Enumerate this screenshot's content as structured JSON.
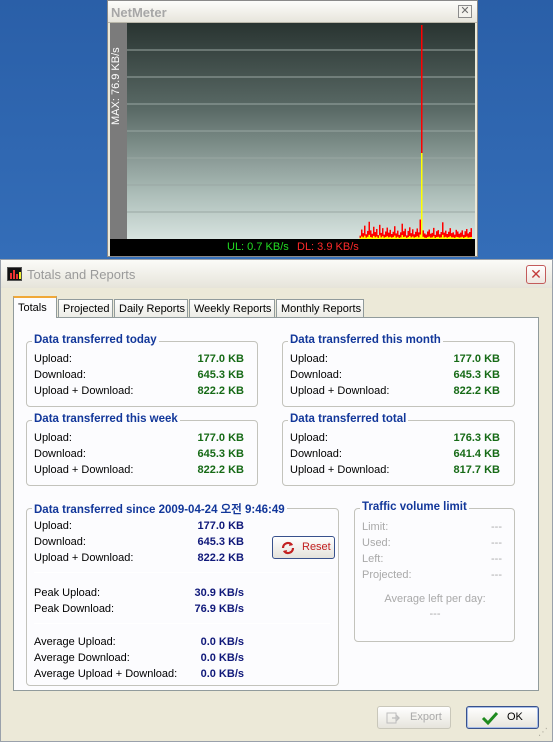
{
  "netmeter": {
    "title": "NetMeter",
    "close_label": "✕",
    "max_label": "MAX: 76.9 KB/s",
    "ul_label": "UL: 0.7 KB/s",
    "dl_label": "DL: 3.9 KB/s",
    "colors": {
      "upload": "#ffff00",
      "download": "#ff0000",
      "ul_text": "#22dd22",
      "dl_text": "#ff2a2a"
    },
    "graph": {
      "max_kbs": 76.9,
      "download_samples": [
        1.2,
        3.4,
        2.1,
        4.8,
        1.7,
        2.9,
        6.2,
        3.1,
        1.9,
        4.4,
        2.5,
        3.6,
        1.4,
        5.1,
        2.2,
        3.9,
        1.6,
        2.7,
        4.1,
        2.3,
        3.3,
        1.8,
        2.6,
        4.6,
        2.0,
        3.0,
        1.5,
        2.4,
        5.5,
        2.8,
        3.7,
        1.3,
        2.9,
        4.2,
        2.1,
        3.5,
        1.7,
        2.6,
        3.8,
        2.4,
        7.0,
        76.9,
        3.1,
        2.0,
        1.6,
        2.7,
        3.4,
        1.9,
        2.2,
        4.0,
        1.5,
        2.8,
        3.2,
        1.7,
        2.5,
        6.0,
        2.3,
        3.0,
        1.8,
        2.6,
        3.9,
        2.1,
        2.4,
        1.6,
        3.3,
        2.7,
        1.9,
        2.3,
        3.1,
        1.5,
        2.8,
        3.6,
        2.0,
        2.5,
        3.9
      ],
      "upload_samples": [
        0.4,
        0.9,
        0.6,
        1.2,
        0.5,
        0.8,
        1.5,
        0.7,
        0.5,
        1.1,
        0.6,
        0.9,
        0.4,
        1.3,
        0.6,
        1.0,
        0.5,
        0.7,
        1.0,
        0.6,
        0.8,
        0.5,
        0.7,
        1.2,
        0.5,
        0.8,
        0.4,
        0.6,
        1.4,
        0.7,
        0.9,
        0.4,
        0.7,
        1.1,
        0.6,
        0.9,
        0.5,
        0.7,
        1.0,
        0.6,
        1.6,
        30.9,
        0.8,
        0.5,
        0.4,
        0.7,
        0.9,
        0.5,
        0.6,
        1.0,
        0.4,
        0.7,
        0.8,
        0.5,
        0.6,
        1.5,
        0.6,
        0.8,
        0.5,
        0.7,
        1.0,
        0.6,
        0.6,
        0.4,
        0.8,
        0.7,
        0.5,
        0.6,
        0.8,
        0.4,
        0.7,
        0.9,
        0.5,
        0.6,
        0.7
      ]
    }
  },
  "dialog": {
    "title": "Totals and Reports",
    "close_label": "✕",
    "tabs": [
      {
        "label": "Totals",
        "active": true
      },
      {
        "label": "Projected",
        "active": false
      },
      {
        "label": "Daily Reports",
        "active": false
      },
      {
        "label": "Weekly Reports",
        "active": false
      },
      {
        "label": "Monthly Reports",
        "active": false
      }
    ],
    "today": {
      "title": "Data transferred today",
      "rows": [
        {
          "label": "Upload:",
          "value": "177.0 KB"
        },
        {
          "label": "Download:",
          "value": "645.3 KB"
        },
        {
          "label": "Upload + Download:",
          "value": "822.2 KB"
        }
      ]
    },
    "month": {
      "title": "Data transferred this month",
      "rows": [
        {
          "label": "Upload:",
          "value": "177.0 KB"
        },
        {
          "label": "Download:",
          "value": "645.3 KB"
        },
        {
          "label": "Upload + Download:",
          "value": "822.2 KB"
        }
      ]
    },
    "week": {
      "title": "Data transferred this week",
      "rows": [
        {
          "label": "Upload:",
          "value": "177.0 KB"
        },
        {
          "label": "Download:",
          "value": "645.3 KB"
        },
        {
          "label": "Upload + Download:",
          "value": "822.2 KB"
        }
      ]
    },
    "total": {
      "title": "Data transferred total",
      "rows": [
        {
          "label": "Upload:",
          "value": "176.3 KB"
        },
        {
          "label": "Download:",
          "value": "641.4 KB"
        },
        {
          "label": "Upload + Download:",
          "value": "817.7 KB"
        }
      ]
    },
    "since": {
      "title": "Data transferred since 2009-04-24 오전 9:46:49",
      "rows": [
        {
          "label": "Upload:",
          "value": "177.0 KB"
        },
        {
          "label": "Download:",
          "value": "645.3 KB"
        },
        {
          "label": "Upload + Download:",
          "value": "822.2 KB"
        }
      ],
      "peak": [
        {
          "label": "Peak Upload:",
          "value": "30.9 KB/s"
        },
        {
          "label": "Peak Download:",
          "value": "76.9 KB/s"
        }
      ],
      "average": [
        {
          "label": "Average Upload:",
          "value": "0.0 KB/s"
        },
        {
          "label": "Average Download:",
          "value": "0.0 KB/s"
        },
        {
          "label": "Average Upload + Download:",
          "value": "0.0 KB/s"
        }
      ],
      "reset_label": "Reset"
    },
    "limit": {
      "title": "Traffic volume limit",
      "rows": [
        {
          "label": "Limit:",
          "value": "---"
        },
        {
          "label": "Used:",
          "value": "---"
        },
        {
          "label": "Left:",
          "value": "---"
        },
        {
          "label": "Projected:",
          "value": "---"
        }
      ],
      "avg_left_label": "Average left per day:",
      "avg_left_value": "---"
    },
    "export_label": "Export",
    "ok_label": "OK",
    "colors": {
      "group_title": "#12379a",
      "green_value": "#166a16",
      "blue_value": "#10197a"
    }
  }
}
